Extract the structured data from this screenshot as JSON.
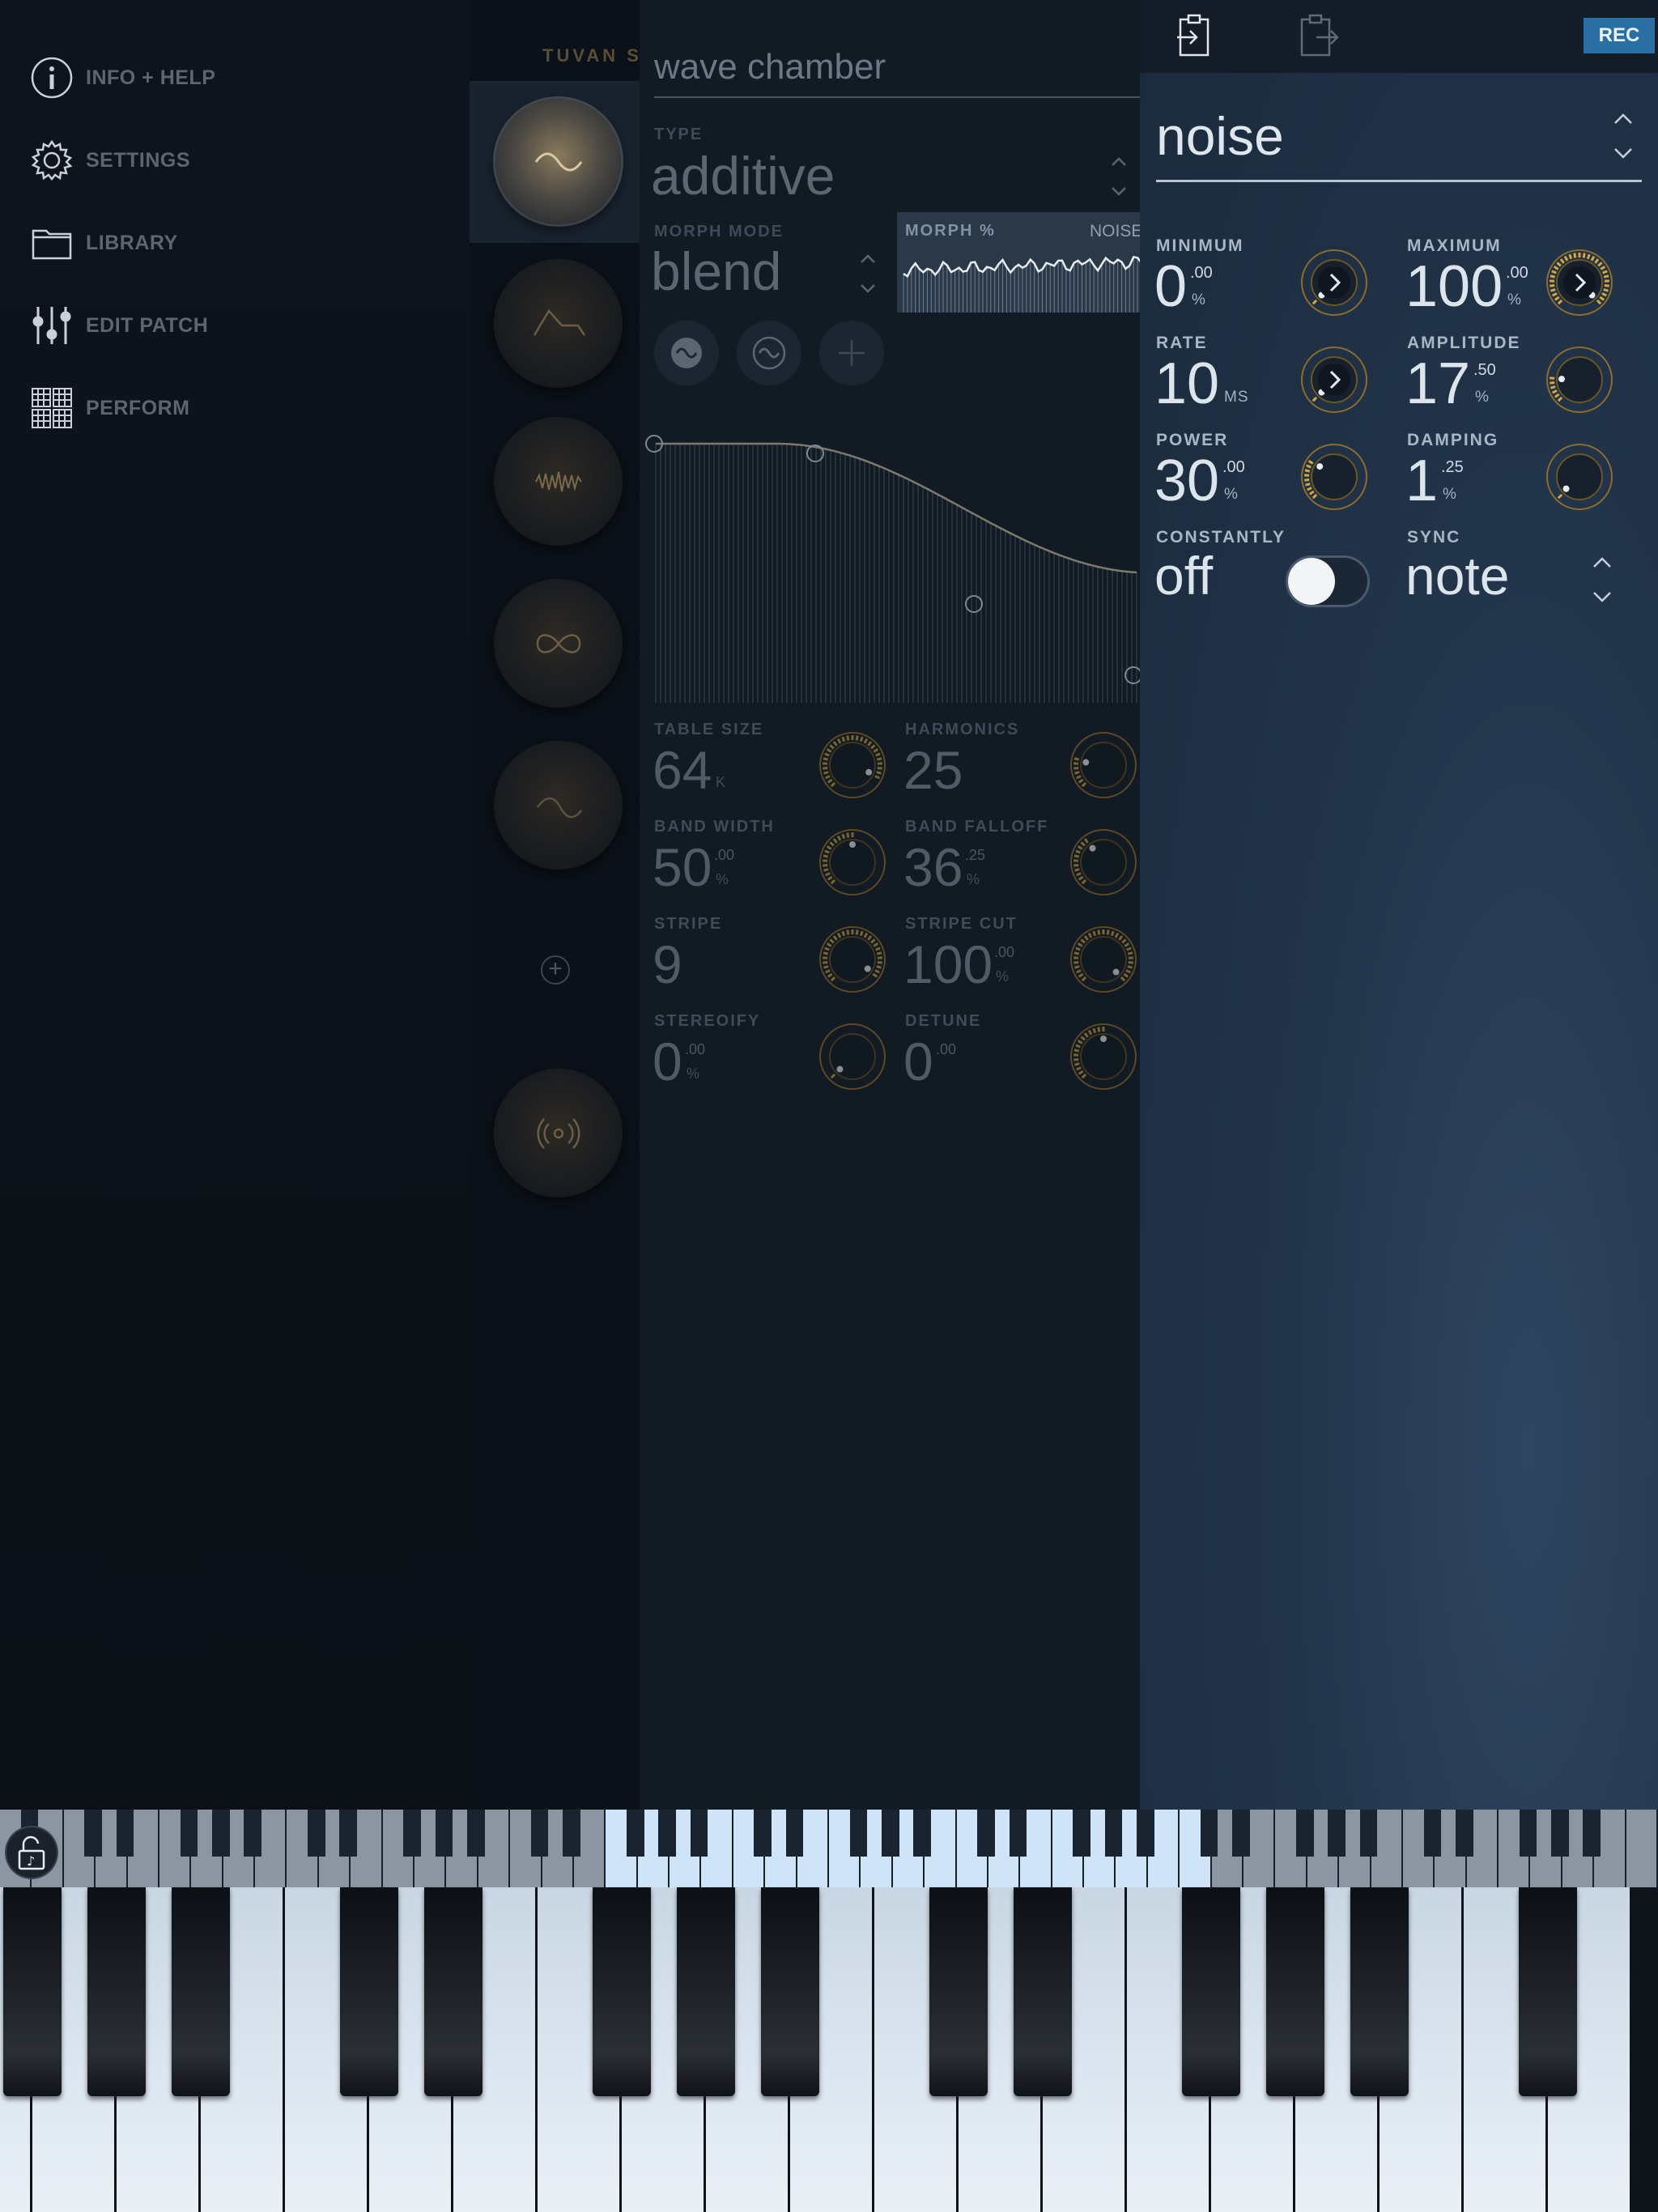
{
  "nav": {
    "info": "INFO + HELP",
    "settings": "SETTINGS",
    "library": "LIBRARY",
    "edit_patch": "EDIT PATCH",
    "perform": "PERFORM"
  },
  "patch_column": {
    "title": "TUVAN S",
    "add_symbol": "+"
  },
  "wave_chamber": {
    "title": "wave chamber",
    "type_label": "TYPE",
    "type_value": "additive",
    "morph_mode_label": "MORPH MODE",
    "morph_mode_value": "blend",
    "morph_pct_label": "MORPH %",
    "morph_source": "NOISE",
    "params": {
      "table_size": {
        "label": "TABLE SIZE",
        "value": "64",
        "unit": "K",
        "level": 0.92
      },
      "harmonics": {
        "label": "HARMONICS",
        "value": "25",
        "level": 0.2
      },
      "band_width": {
        "label": "BAND WIDTH",
        "value": "50",
        "sup": ".00",
        "unit": "%",
        "level": 0.5
      },
      "band_falloff": {
        "label": "BAND FALLOFF",
        "value": "36",
        "sup": ".25",
        "unit": "%",
        "level": 0.36
      },
      "stripe": {
        "label": "STRIPE",
        "value": "9",
        "level": 0.95
      },
      "stripe_cut": {
        "label": "STRIPE CUT",
        "value": "100",
        "sup": ".00",
        "unit": "%",
        "level": 1.0
      },
      "stereoify": {
        "label": "STEREOIFY",
        "value": "0",
        "sup": ".00",
        "unit": "%",
        "level": 0.0
      },
      "detune": {
        "label": "DETUNE",
        "value": "0",
        "sup": ".00",
        "level": 0.5
      }
    }
  },
  "modulator": {
    "title": "noise",
    "rec_label": "REC",
    "minimum": {
      "label": "MINIMUM",
      "value": "0",
      "sup": ".00",
      "unit": "%",
      "level": 0.0
    },
    "maximum": {
      "label": "MAXIMUM",
      "value": "100",
      "sup": ".00",
      "unit": "%",
      "level": 1.0
    },
    "rate": {
      "label": "RATE",
      "value": "10",
      "unit": "MS",
      "level": 0.0
    },
    "amplitude": {
      "label": "AMPLITUDE",
      "value": "17",
      "sup": ".50",
      "unit": "%",
      "level": 0.175
    },
    "power": {
      "label": "POWER",
      "value": "30",
      "sup": ".00",
      "unit": "%",
      "level": 0.3
    },
    "damping": {
      "label": "DAMPING",
      "value": "1",
      "sup": ".25",
      "unit": "%",
      "level": 0.0125
    },
    "constantly": {
      "label": "CONSTANTLY",
      "value": "off",
      "on": false
    },
    "sync": {
      "label": "SYNC",
      "value": "note"
    }
  },
  "colors": {
    "accent_gold": "#d6a63c",
    "rec_blue": "#2a6fa3",
    "key_white": "#dde7f1",
    "key_highlight": "#cfe4f8"
  }
}
